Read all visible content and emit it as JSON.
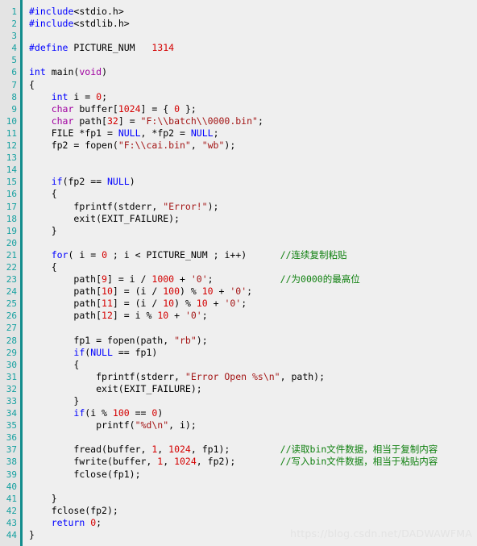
{
  "editor": {
    "language": "c",
    "first_line": 1,
    "total_lines": 44,
    "colors": {
      "background": "#efefef",
      "gutter_background": "#e4e4e4",
      "gutter_rule": "#138d8d",
      "line_number": "#16a0a0",
      "keyword": "#0000ff",
      "type": "#a000a0",
      "number": "#d40000",
      "string": "#a31515",
      "comment": "#108010",
      "plain": "#000000",
      "watermark": "#e3e3e3"
    }
  },
  "watermark": {
    "text": "https://blog.csdn.net/DADWAWFMA"
  },
  "line_numbers": [
    "1",
    "2",
    "3",
    "4",
    "5",
    "6",
    "7",
    "8",
    "9",
    "10",
    "11",
    "12",
    "13",
    "14",
    "15",
    "16",
    "17",
    "18",
    "19",
    "20",
    "21",
    "22",
    "23",
    "24",
    "25",
    "26",
    "27",
    "28",
    "29",
    "30",
    "31",
    "32",
    "33",
    "34",
    "35",
    "36",
    "37",
    "38",
    "39",
    "40",
    "41",
    "42",
    "43",
    "44"
  ],
  "code": {
    "lines": [
      {
        "n": 1,
        "text": "#include<stdio.h>"
      },
      {
        "n": 2,
        "text": "#include<stdlib.h>"
      },
      {
        "n": 3,
        "text": ""
      },
      {
        "n": 4,
        "text": "#define PICTURE_NUM   1314"
      },
      {
        "n": 5,
        "text": ""
      },
      {
        "n": 6,
        "text": "int main(void)"
      },
      {
        "n": 7,
        "text": "{"
      },
      {
        "n": 8,
        "text": "    int i = 0;"
      },
      {
        "n": 9,
        "text": "    char buffer[1024] = { 0 };"
      },
      {
        "n": 10,
        "text": "    char path[32] = \"F:\\\\batch\\\\0000.bin\";"
      },
      {
        "n": 11,
        "text": "    FILE *fp1 = NULL, *fp2 = NULL;"
      },
      {
        "n": 12,
        "text": "    fp2 = fopen(\"F:\\\\cai.bin\", \"wb\");"
      },
      {
        "n": 13,
        "text": ""
      },
      {
        "n": 14,
        "text": ""
      },
      {
        "n": 15,
        "text": "    if(fp2 == NULL)"
      },
      {
        "n": 16,
        "text": "    {"
      },
      {
        "n": 17,
        "text": "        fprintf(stderr, \"Error!\");"
      },
      {
        "n": 18,
        "text": "        exit(EXIT_FAILURE);"
      },
      {
        "n": 19,
        "text": "    }"
      },
      {
        "n": 20,
        "text": ""
      },
      {
        "n": 21,
        "text": "    for( i = 0 ; i < PICTURE_NUM ; i++)",
        "comment": "//连续复制粘贴"
      },
      {
        "n": 22,
        "text": "    {"
      },
      {
        "n": 23,
        "text": "        path[9] = i / 1000 + '0';",
        "comment": "//为0000的最高位"
      },
      {
        "n": 24,
        "text": "        path[10] = (i / 100) % 10 + '0';"
      },
      {
        "n": 25,
        "text": "        path[11] = (i / 10) % 10 + '0';"
      },
      {
        "n": 26,
        "text": "        path[12] = i % 10 + '0';"
      },
      {
        "n": 27,
        "text": ""
      },
      {
        "n": 28,
        "text": "        fp1 = fopen(path, \"rb\");"
      },
      {
        "n": 29,
        "text": "        if(NULL == fp1)"
      },
      {
        "n": 30,
        "text": "        {"
      },
      {
        "n": 31,
        "text": "            fprintf(stderr, \"Error Open %s\\n\", path);"
      },
      {
        "n": 32,
        "text": "            exit(EXIT_FAILURE);"
      },
      {
        "n": 33,
        "text": "        }"
      },
      {
        "n": 34,
        "text": "        if(i % 100 == 0)"
      },
      {
        "n": 35,
        "text": "            printf(\"%d\\n\", i);"
      },
      {
        "n": 36,
        "text": ""
      },
      {
        "n": 37,
        "text": "        fread(buffer, 1, 1024, fp1);",
        "comment": "//读取bin文件数据，相当于复制内容"
      },
      {
        "n": 38,
        "text": "        fwrite(buffer, 1, 1024, fp2);",
        "comment": "//写入bin文件数据，相当于粘贴内容"
      },
      {
        "n": 39,
        "text": "        fclose(fp1);"
      },
      {
        "n": 40,
        "text": ""
      },
      {
        "n": 41,
        "text": "    }"
      },
      {
        "n": 42,
        "text": "    fclose(fp2);"
      },
      {
        "n": 43,
        "text": "    return 0;"
      },
      {
        "n": 44,
        "text": "}"
      }
    ]
  }
}
